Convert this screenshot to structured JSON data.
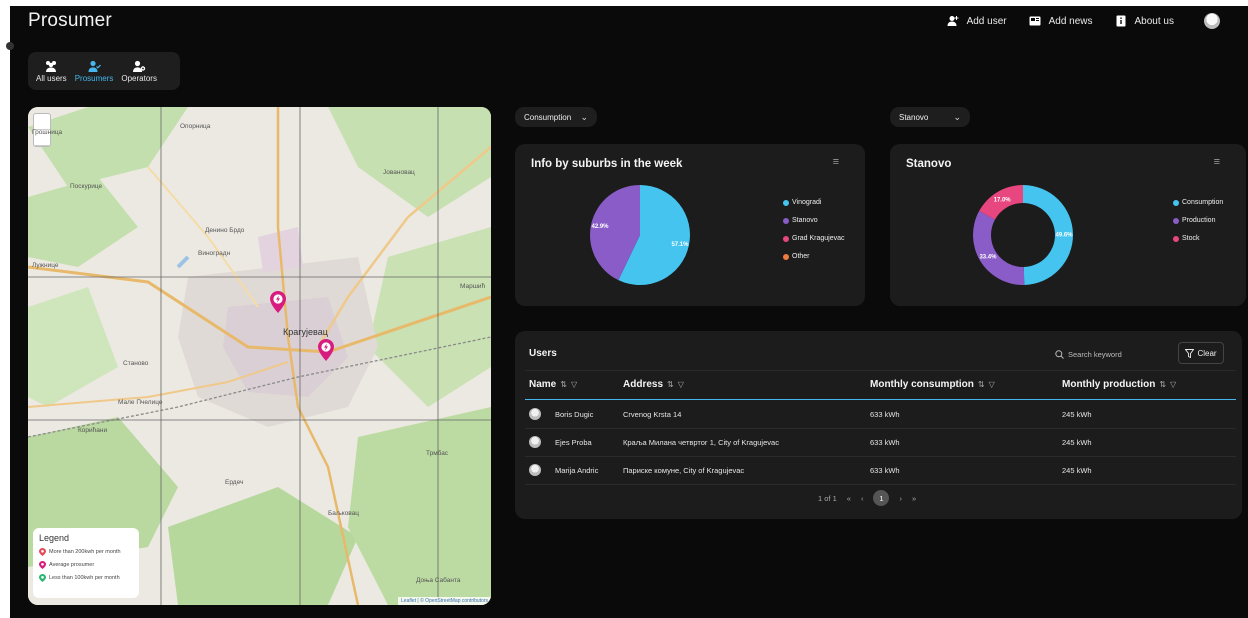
{
  "app": {
    "title": "Prosumer",
    "top_actions": [
      {
        "label": "Add user",
        "icon": "add-user-icon"
      },
      {
        "label": "Add news",
        "icon": "news-icon"
      },
      {
        "label": "About us",
        "icon": "info-book-icon"
      }
    ]
  },
  "user_tabs": [
    {
      "label": "All users",
      "icon": "users-group-icon",
      "active": false
    },
    {
      "label": "Prosumers",
      "icon": "user-check-icon",
      "active": true
    },
    {
      "label": "Operators",
      "icon": "user-gear-icon",
      "active": false
    }
  ],
  "map": {
    "labels": {
      "city": "Крагујевац",
      "l1": "Опорница",
      "l2": "Јовановац",
      "l3": "Поскурице",
      "l4": "Денино Брдо",
      "l5": "Виноградн",
      "l6": "Станово",
      "l7": "Мале Пчелице",
      "l8": "Корићани",
      "l9": "Трмбас",
      "l10": "Баљковац",
      "l11": "Доња Сабанта",
      "l12": "Маршић",
      "l13": "Ердеч",
      "l14": "Грошница",
      "l15": "Лужнице"
    },
    "legend": {
      "title": "Legend",
      "items": [
        {
          "label": "More than 200kwh per month",
          "color": "#e44a5a"
        },
        {
          "label": "Average prosumer",
          "color": "#d81b7f"
        },
        {
          "label": "Less than 100kwh per month",
          "color": "#2bb673"
        }
      ]
    },
    "attribution": "Leaflet | © OpenStreetMap contributors"
  },
  "filters": {
    "metric": "Consumption",
    "suburb": "Stanovo"
  },
  "colors": {
    "cyan": "#45c4f0",
    "purple": "#8a5cc8",
    "pink": "#e8467e",
    "orange": "#f07b3f",
    "accent": "#46b6ec"
  },
  "pie_card": {
    "title": "Info by suburbs in the week",
    "legend": [
      "Vinogradi",
      "Stanovo",
      "Grad Kragujevac",
      "Other"
    ]
  },
  "donut_card": {
    "title": "Stanovo",
    "legend": [
      "Consumption",
      "Production",
      "Stock"
    ]
  },
  "chart_data": [
    {
      "type": "pie",
      "categories": [
        "Vinogradi",
        "Stanovo",
        "Grad Kragujevac",
        "Other"
      ],
      "values": [
        57.1,
        42.9,
        0,
        0
      ],
      "labels": [
        "57.1%",
        "42.9%"
      ],
      "title": "Info by suburbs in the week",
      "legend_position": "right"
    },
    {
      "type": "pie",
      "donut": true,
      "categories": [
        "Consumption",
        "Production",
        "Stock"
      ],
      "values": [
        49.6,
        33.4,
        17.0
      ],
      "labels": [
        "49.6%",
        "33.4%",
        "17.0%"
      ],
      "title": "Stanovo",
      "legend_position": "right"
    }
  ],
  "users_table": {
    "title": "Users",
    "search_placeholder": "Search keyword",
    "clear_label": "Clear",
    "columns": [
      "Name",
      "Address",
      "Monthly consumption",
      "Monthly production"
    ],
    "rows": [
      {
        "name": "Boris Dugic",
        "address": "Crvenog Krsta 14",
        "consumption": "633 kWh",
        "production": "245 kWh"
      },
      {
        "name": "Ejes Proba",
        "address": "Краља Милана четвртог 1, City of Kragujevac",
        "consumption": "633 kWh",
        "production": "245 kWh"
      },
      {
        "name": "Marija Andric",
        "address": "Париске комуне, City of Kragujevac",
        "consumption": "633 kWh",
        "production": "245 kWh"
      }
    ],
    "pagination": {
      "summary": "1 of 1",
      "current": "1",
      "first": "«",
      "prev": "‹",
      "next": "›",
      "last": "»"
    }
  }
}
